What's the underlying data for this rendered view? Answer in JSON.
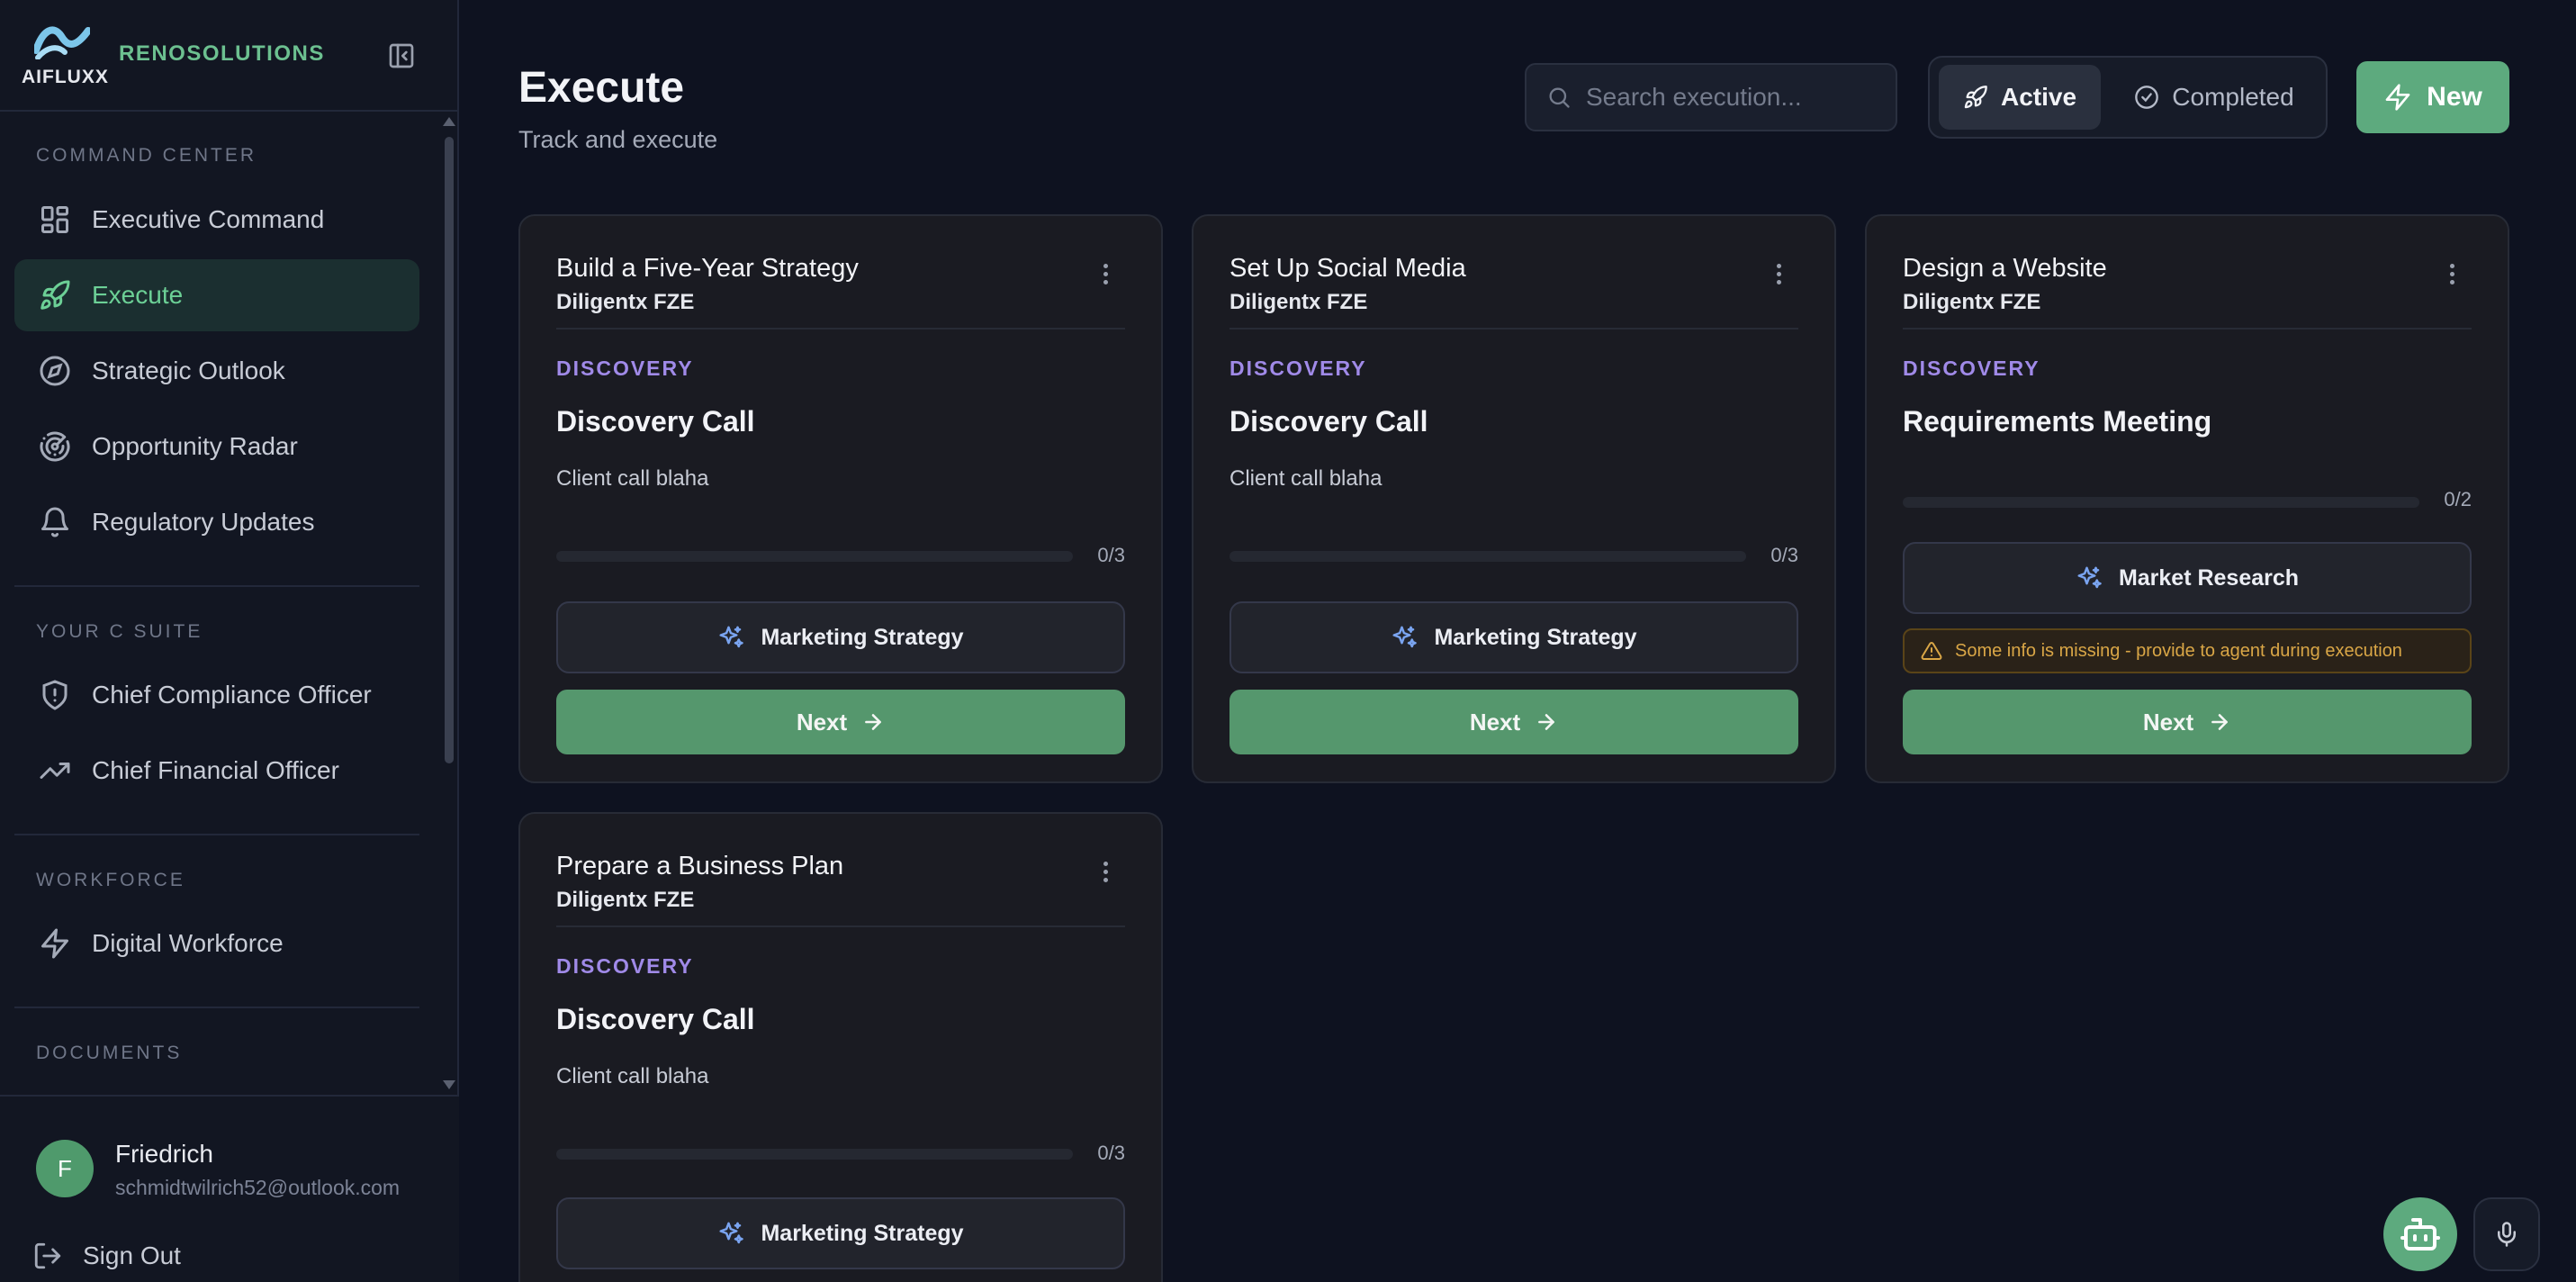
{
  "brand": {
    "logo_text": "AIFLUXX",
    "company": "RENOSOLUTIONS"
  },
  "sidebar": {
    "sections": [
      {
        "label": "COMMAND CENTER"
      },
      {
        "label": "YOUR C SUITE"
      },
      {
        "label": "WORKFORCE"
      },
      {
        "label": "DOCUMENTS"
      }
    ],
    "items": [
      {
        "label": "Executive Command",
        "icon": "grid-icon"
      },
      {
        "label": "Execute",
        "icon": "rocket-icon",
        "active": true
      },
      {
        "label": "Strategic Outlook",
        "icon": "compass-icon"
      },
      {
        "label": "Opportunity Radar",
        "icon": "radar-icon"
      },
      {
        "label": "Regulatory Updates",
        "icon": "bell-icon"
      },
      {
        "label": "Chief Compliance Officer",
        "icon": "shield-icon"
      },
      {
        "label": "Chief Financial Officer",
        "icon": "trending-up-icon"
      },
      {
        "label": "Digital Workforce",
        "icon": "bolt-icon"
      }
    ]
  },
  "user": {
    "initial": "F",
    "name": "Friedrich",
    "email": "schmidtwilrich52@outlook.com",
    "sign_out": "Sign Out"
  },
  "header": {
    "title": "Execute",
    "subtitle": "Track and execute",
    "search_placeholder": "Search execution...",
    "tabs": [
      {
        "label": "Active",
        "selected": true
      },
      {
        "label": "Completed",
        "selected": false
      }
    ],
    "new_label": "New"
  },
  "cards": [
    {
      "title": "Build a Five-Year Strategy",
      "company": "Diligentx FZE",
      "phase": "DISCOVERY",
      "step": "Discovery Call",
      "description": "Client call blaha",
      "progress_label": "0/3",
      "progress": 0,
      "agent": "Marketing Strategy",
      "next_label": "Next"
    },
    {
      "title": "Set Up Social Media",
      "company": "Diligentx FZE",
      "phase": "DISCOVERY",
      "step": "Discovery Call",
      "description": "Client call blaha",
      "progress_label": "0/3",
      "progress": 0,
      "agent": "Marketing Strategy",
      "next_label": "Next"
    },
    {
      "title": "Design a Website",
      "company": "Diligentx FZE",
      "phase": "DISCOVERY",
      "step": "Requirements Meeting",
      "progress_label": "0/2",
      "progress": 0,
      "agent": "Market Research",
      "warning": "Some info is missing - provide to agent during execution",
      "next_label": "Next"
    },
    {
      "title": "Prepare a Business Plan",
      "company": "Diligentx FZE",
      "phase": "DISCOVERY",
      "step": "Discovery Call",
      "description": "Client call blaha",
      "progress_label": "0/3",
      "progress": 0,
      "agent": "Marketing Strategy"
    }
  ],
  "colors": {
    "accent": "#5daa7e",
    "phase": "#a08ae8",
    "warning": "#d9a646",
    "background": "#0e1220"
  }
}
